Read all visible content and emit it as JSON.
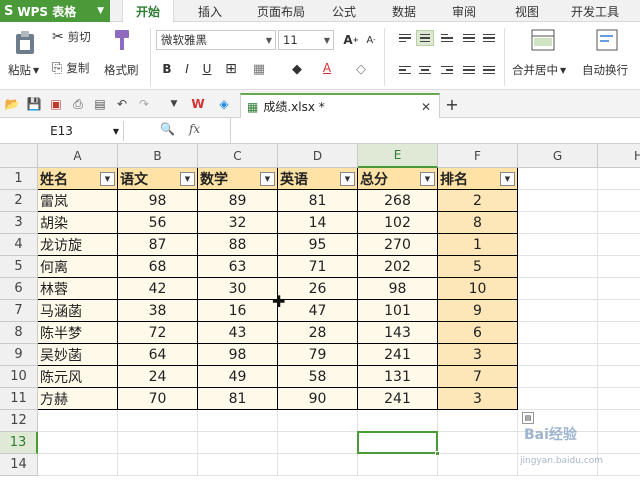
{
  "app": {
    "name": "WPS 表格"
  },
  "tabs": [
    "开始",
    "插入",
    "页面布局",
    "公式",
    "数据",
    "审阅",
    "视图",
    "开发工具"
  ],
  "active_tab": "开始",
  "ribbon": {
    "paste": "粘贴",
    "cut": "剪切",
    "copy": "复制",
    "format_painter": "格式刷",
    "font_name": "微软雅黑",
    "font_size": "11",
    "merge_center": "合并居中",
    "wrap_text": "自动换行"
  },
  "document": {
    "tab_title": "成绩.xlsx *"
  },
  "formula_bar": {
    "cell_ref": "E13",
    "value": ""
  },
  "sheet": {
    "columns": [
      "A",
      "B",
      "C",
      "D",
      "E",
      "F",
      "G",
      "H"
    ],
    "rows": [
      "1",
      "2",
      "3",
      "4",
      "5",
      "6",
      "7",
      "8",
      "9",
      "10",
      "11",
      "12",
      "13",
      "14"
    ],
    "headers": [
      "姓名",
      "语文",
      "数学",
      "英语",
      "总分",
      "排名"
    ],
    "data": [
      [
        "雷岚",
        "98",
        "89",
        "81",
        "268",
        "2"
      ],
      [
        "胡染",
        "56",
        "32",
        "14",
        "102",
        "8"
      ],
      [
        "龙访旋",
        "87",
        "88",
        "95",
        "270",
        "1"
      ],
      [
        "何离",
        "68",
        "63",
        "71",
        "202",
        "5"
      ],
      [
        "林蓉",
        "42",
        "30",
        "26",
        "98",
        "10"
      ],
      [
        "马涵菡",
        "38",
        "16",
        "47",
        "101",
        "9"
      ],
      [
        "陈半梦",
        "72",
        "43",
        "28",
        "143",
        "6"
      ],
      [
        "吴妙菡",
        "64",
        "98",
        "79",
        "241",
        "3"
      ],
      [
        "陈元风",
        "24",
        "49",
        "58",
        "131",
        "7"
      ],
      [
        "方赫",
        "70",
        "81",
        "90",
        "241",
        "3"
      ]
    ],
    "selected_cell": "E13"
  },
  "watermark": {
    "text": "Bai经验",
    "url": "jingyan.baidu.com"
  },
  "colors": {
    "accent": "#4a9a3a",
    "table_fill": "#fff9ea",
    "header_fill": "#ffe3a6",
    "rank_fill": "#fde6b8"
  }
}
